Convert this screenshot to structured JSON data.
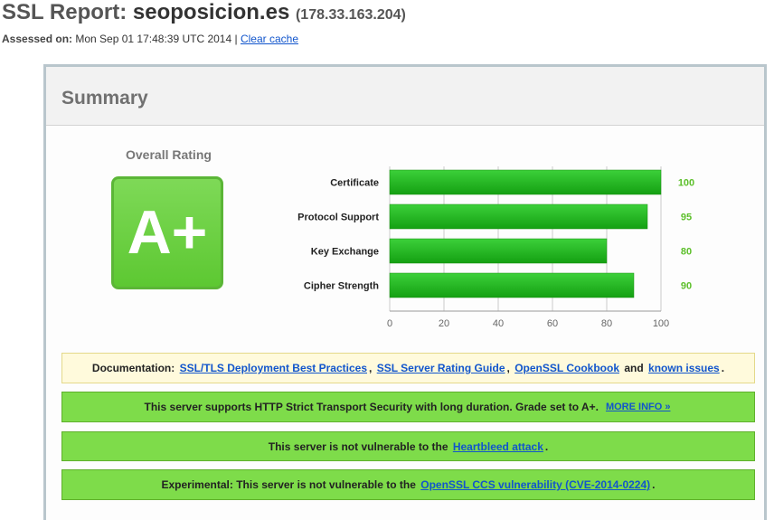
{
  "header": {
    "title_prefix": "SSL Report:",
    "host": "seoposicion.es",
    "ip": "(178.33.163.204)",
    "assessed_label": "Assessed on:",
    "assessed_date": "Mon Sep 01 17:48:39 UTC 2014",
    "separator": "|",
    "clear_cache": "Clear cache"
  },
  "summary": {
    "title": "Summary",
    "overall_rating_label": "Overall Rating",
    "grade": "A+",
    "grade_color": "#66cc33"
  },
  "chart_data": {
    "type": "bar",
    "orientation": "horizontal",
    "categories": [
      "Certificate",
      "Protocol Support",
      "Key Exchange",
      "Cipher Strength"
    ],
    "values": [
      100,
      95,
      80,
      90
    ],
    "xlim": [
      0,
      100
    ],
    "xticks": [
      "0",
      "20",
      "40",
      "60",
      "80",
      "100"
    ],
    "grid": true,
    "bar_color": "#22b01a",
    "value_label_color": "#5cbf2a"
  },
  "messages": {
    "documentation": {
      "prefix": "Documentation:",
      "link1": "SSL/TLS Deployment Best Practices",
      "sep1": ",",
      "link2": "SSL Server Rating Guide",
      "sep2": ",",
      "link3": "OpenSSL Cookbook",
      "and": "and",
      "link4": "known issues",
      "suffix": "."
    },
    "hsts": {
      "text": "This server supports HTTP Strict Transport Security with long duration. Grade set to A+.",
      "link": "MORE INFO »"
    },
    "heartbleed": {
      "text": "This server is not vulnerable to the",
      "link": "Heartbleed attack",
      "suffix": "."
    },
    "ccs": {
      "text": "Experimental: This server is not vulnerable to the",
      "link": "OpenSSL CCS vulnerability (CVE-2014-0224)",
      "suffix": "."
    },
    "ok_color": "#7edc4a",
    "doc_color": "#fffadc"
  }
}
